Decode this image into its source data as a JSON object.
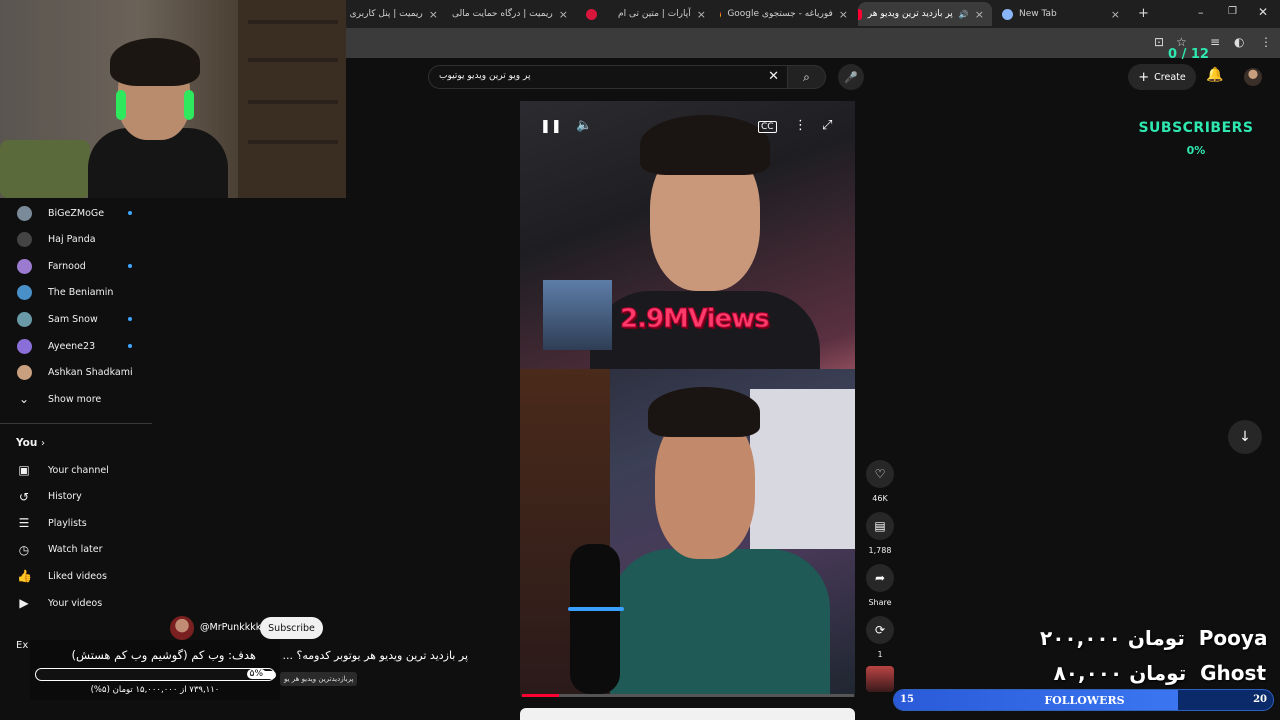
{
  "browser": {
    "tabs": [
      {
        "title": "ریمیت | پنل کاربری",
        "active": false
      },
      {
        "title": "ریمیت | درگاه حمایت مالی",
        "active": false
      },
      {
        "title": "آپارات | متین تی ام",
        "active": false
      },
      {
        "title": "فوریاغه - جستجوی Google",
        "active": false
      },
      {
        "title": "پر بازدید ترین ویدیو هر",
        "active": true
      },
      {
        "title": "New Tab",
        "active": false
      }
    ]
  },
  "youtube": {
    "search": {
      "value": "پر ویو ترین ویدیو یوتیوب"
    },
    "create_label": "Create"
  },
  "sidebar": {
    "subscriptions": [
      {
        "label": "BiGeZMoGe",
        "new": true,
        "color": "#7a8a99"
      },
      {
        "label": "Haj Panda",
        "new": false,
        "color": "#444"
      },
      {
        "label": "Farnood",
        "new": true,
        "color": "#9b7bd0"
      },
      {
        "label": "The Beniamin",
        "new": false,
        "color": "#4a90c8"
      },
      {
        "label": "Sam Snow",
        "new": true,
        "color": "#6a9aa8"
      },
      {
        "label": "Ayeene23",
        "new": true,
        "color": "#8a6fd8"
      },
      {
        "label": "Ashkan Shadkami",
        "new": false,
        "color": "#c8a080"
      }
    ],
    "show_more": "Show more",
    "you_header": "You",
    "you_items": [
      {
        "label": "Your channel",
        "icon": "channel-icon"
      },
      {
        "label": "History",
        "icon": "history-icon"
      },
      {
        "label": "Playlists",
        "icon": "playlists-icon"
      },
      {
        "label": "Watch later",
        "icon": "watch-later-icon"
      },
      {
        "label": "Liked videos",
        "icon": "liked-icon"
      },
      {
        "label": "Your videos",
        "icon": "your-videos-icon"
      }
    ],
    "explore_partial": "Ex"
  },
  "video": {
    "banner_main": "2.9M",
    "banner_suffix": "Views",
    "actions": {
      "likes": "46K",
      "comments": "1,788",
      "share": "Share",
      "remix": "1"
    },
    "progress": 0.11,
    "channel": "@MrPunkkkk",
    "subscribe": "Subscribe",
    "title": "پر بازدید ترین ویدیو هر یوتوبر کدومه؟ ...",
    "music": "پربازدیدترین ویدیو هر یو"
  },
  "overlay": {
    "subscriber_counter": "0 / 12",
    "subscriber_title": "SUBSCRIBERS",
    "subscriber_pct": "0%",
    "donors": [
      {
        "name": "Pooya",
        "amount": "۲۰۰,۰۰۰ تومان"
      },
      {
        "name": "Ghost",
        "amount": "۸۰,۰۰۰ تومان"
      }
    ],
    "followers": {
      "label": "FOLLOWERS",
      "min": "15",
      "max": "20",
      "progress": 0.75
    },
    "goal": {
      "title": "هدف: وب کم (گوشیم وب کم هستش)",
      "percent": "۵%",
      "progress": 0.05,
      "amount": "۷۳۹,۱۱۰ از ۱۵,۰۰۰,۰۰۰ تومان (۵%)"
    }
  }
}
